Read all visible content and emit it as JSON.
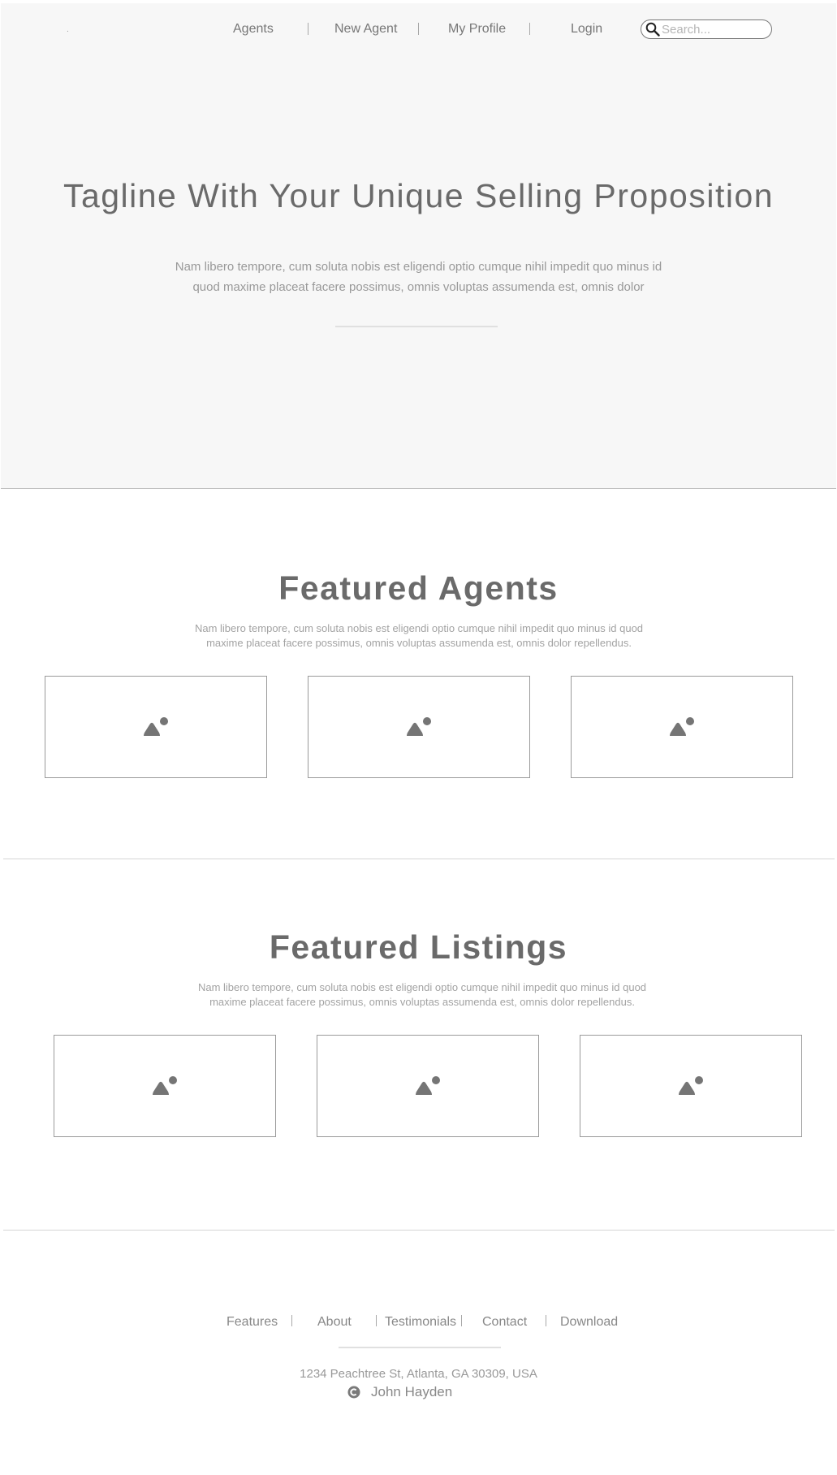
{
  "header": {
    "brand_mark": ".",
    "nav": [
      {
        "label": "Agents"
      },
      {
        "label": "New Agent"
      },
      {
        "label": "My Profile"
      },
      {
        "label": "Login"
      }
    ],
    "search": {
      "placeholder": "Search...",
      "value": ""
    }
  },
  "hero": {
    "tagline": "Tagline With Your Unique Selling Proposition",
    "subtitle_line1": "Nam libero tempore, cum soluta nobis est eligendi optio cumque nihil impedit quo minus id",
    "subtitle_line2": "quod maxime placeat facere possimus, omnis voluptas assumenda est, omnis dolor"
  },
  "featured_agents": {
    "title": "Featured Agents",
    "subtitle_line1": "Nam libero tempore, cum soluta nobis est eligendi optio cumque nihil impedit quo minus id quod",
    "subtitle_line2": "maxime placeat facere possimus, omnis voluptas assumenda est, omnis dolor repellendus.",
    "cards": [
      {
        "icon": "image-placeholder-icon"
      },
      {
        "icon": "image-placeholder-icon"
      },
      {
        "icon": "image-placeholder-icon"
      }
    ]
  },
  "featured_listings": {
    "title": "Featured Listings",
    "subtitle_line1": "Nam libero tempore, cum soluta nobis est eligendi optio cumque nihil impedit quo minus id quod",
    "subtitle_line2": "maxime placeat facere possimus, omnis voluptas assumenda est, omnis dolor repellendus.",
    "cards": [
      {
        "icon": "image-placeholder-icon"
      },
      {
        "icon": "image-placeholder-icon"
      },
      {
        "icon": "image-placeholder-icon"
      }
    ]
  },
  "footer": {
    "links": [
      {
        "label": "Features"
      },
      {
        "label": "About"
      },
      {
        "label": "Testimonials"
      },
      {
        "label": "Contact"
      },
      {
        "label": "Download"
      }
    ],
    "address": "1234 Peachtree St, Atlanta, GA 30309, USA",
    "copyright_name": "John Hayden",
    "copyright_icon": "copyright-icon"
  },
  "colors": {
    "hero_background": "#f7f7f7",
    "text_primary": "#6a6a6a",
    "text_muted": "#a3a3a3",
    "card_border": "#9a9a9a",
    "icon_fill": "#757575"
  }
}
